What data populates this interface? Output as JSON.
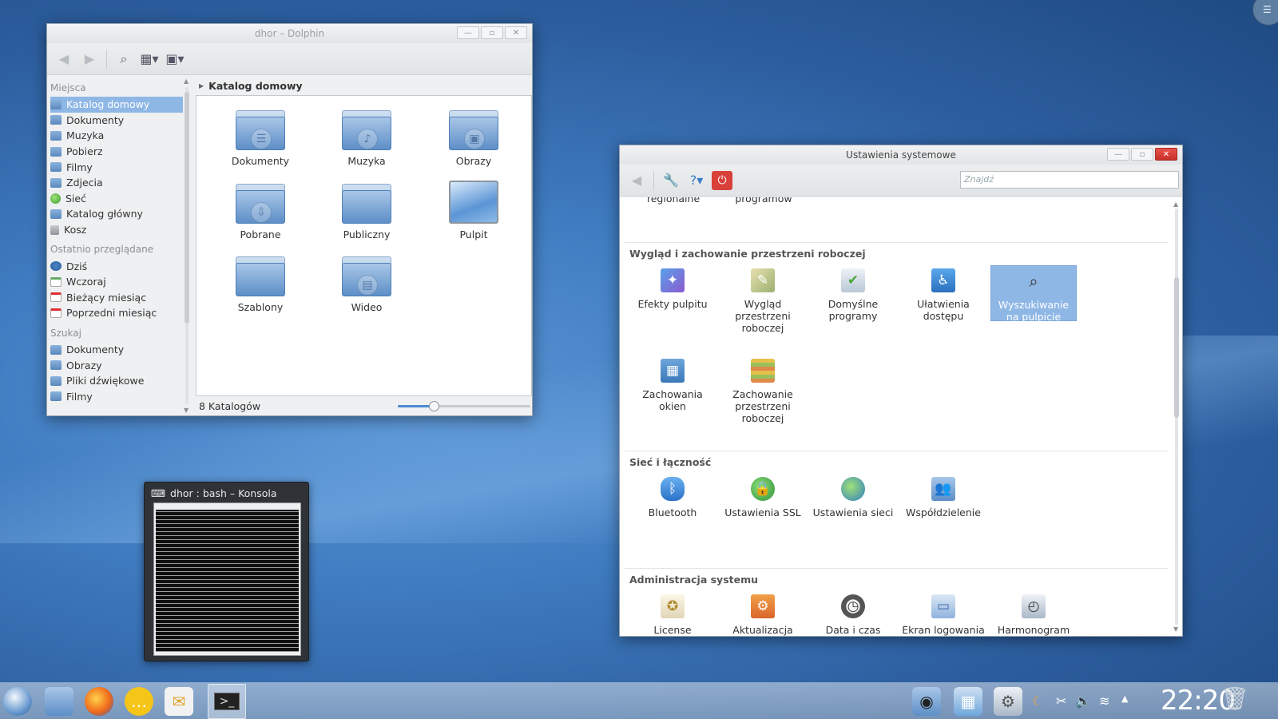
{
  "dolphin": {
    "title": "dhor – Dolphin",
    "places_section": "Miejsca",
    "places": [
      "Katalog domowy",
      "Dokumenty",
      "Muzyka",
      "Pobierz",
      "Filmy",
      "Zdjecia",
      "Sieć",
      "Katalog główny",
      "Kosz"
    ],
    "recent_section": "Ostatnio przeglądane",
    "recent": [
      "Dziś",
      "Wczoraj",
      "Bieżący miesiąc",
      "Poprzedni miesiąc"
    ],
    "search_section": "Szukaj",
    "search": [
      "Dokumenty",
      "Obrazy",
      "Pliki dźwiękowe",
      "Filmy"
    ],
    "breadcrumb": "Katalog domowy",
    "folders": [
      "Dokumenty",
      "Muzyka",
      "Obrazy",
      "Pobrane",
      "Publiczny",
      "Pulpit",
      "Szablony",
      "Wideo"
    ],
    "status": "8 Katalogów",
    "zoom_level": 0.27
  },
  "settings": {
    "title": "Ustawienia systemowe",
    "search_placeholder": "Znajdź",
    "cut_items": [
      "regionalne",
      "programów"
    ],
    "group1": {
      "title": "Wygląd i zachowanie przestrzeni roboczej",
      "items": [
        {
          "label": "Efekty pulpitu",
          "icon": "desktop-effects-icon"
        },
        {
          "label": "Wygląd przestrzeni roboczej",
          "icon": "workspace-appearance-icon"
        },
        {
          "label": "Domyślne programy",
          "icon": "default-apps-icon"
        },
        {
          "label": "Ułatwienia dostępu",
          "icon": "accessibility-icon"
        },
        {
          "label": "Wyszukiwanie na pulpicie",
          "icon": "desktop-search-icon"
        },
        {
          "label": "Zachowania okien",
          "icon": "window-behavior-icon"
        },
        {
          "label": "Zachowanie przestrzeni roboczej",
          "icon": "workspace-behavior-icon"
        }
      ]
    },
    "group2": {
      "title": "Sieć i łączność",
      "items": [
        {
          "label": "Bluetooth",
          "icon": "bluetooth-icon"
        },
        {
          "label": "Ustawienia SSL",
          "icon": "ssl-icon"
        },
        {
          "label": "Ustawienia sieci",
          "icon": "network-icon"
        },
        {
          "label": "Współdzielenie",
          "icon": "sharing-icon"
        }
      ]
    },
    "group3": {
      "title": "Administracja systemu",
      "items": [
        {
          "label": "License",
          "icon": "license-icon"
        },
        {
          "label": "Aktualizacja",
          "icon": "update-icon"
        },
        {
          "label": "Data i czas",
          "icon": "clock-icon"
        },
        {
          "label": "Ekran logowania",
          "icon": "login-screen-icon"
        },
        {
          "label": "Harmonogram",
          "icon": "scheduler-icon"
        }
      ]
    }
  },
  "konsole": {
    "title": "dhor : bash – Konsola"
  },
  "panel": {
    "clock": "22:20"
  },
  "colors": {
    "selection": "#8fb7e6",
    "accent": "#4a8bd0",
    "close": "#d9403a"
  }
}
